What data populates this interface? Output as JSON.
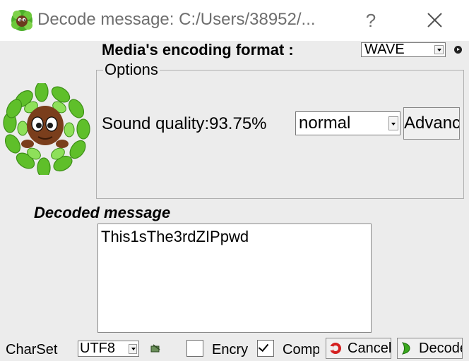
{
  "window": {
    "title": "Decode message: C:/Users/38952/...",
    "help_label": "?"
  },
  "encoding": {
    "label": "Media's encoding format :",
    "selected": "WAVE"
  },
  "options": {
    "legend": "Options",
    "sound_quality_label": "Sound quality:93.75%",
    "quality_selected": "normal",
    "advanced_label": "Advanced"
  },
  "decoded": {
    "label": "Decoded message",
    "text": "This1sThe3rdZIPpwd"
  },
  "bottom": {
    "charset_label": "CharSet",
    "charset_selected": "UTF8",
    "encrypt_label": "Encrypt",
    "encrypt_checked": false,
    "compress_label": "Compress",
    "compress_checked": true,
    "cancel_label": "Cancel",
    "decode_label": "Decode"
  },
  "colors": {
    "window_bg": "#ececec",
    "titlebar_bg": "#ffffff",
    "mascot_leaf": "#5fbf2a",
    "cancel_icon": "#d42020",
    "decode_icon": "#3aa81e"
  }
}
